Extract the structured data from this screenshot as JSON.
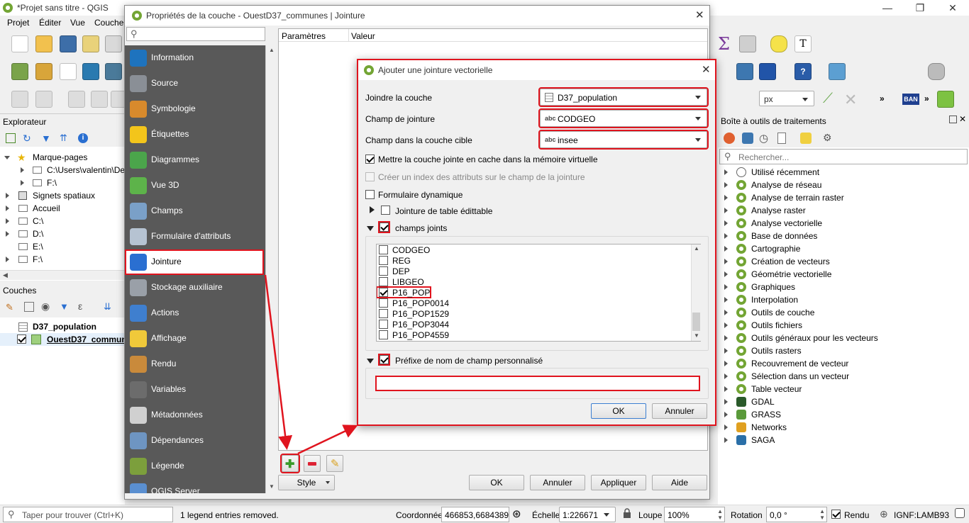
{
  "main_window": {
    "title": "*Projet sans titre - QGIS",
    "menu": [
      "Projet",
      "Éditer",
      "Vue",
      "Couche"
    ]
  },
  "explorer": {
    "title": "Explorateur",
    "items": [
      {
        "label": "Marque-pages",
        "level": 0
      },
      {
        "label": "C:\\Users\\valentin\\De",
        "level": 1
      },
      {
        "label": "F:\\",
        "level": 1
      },
      {
        "label": "Signets spatiaux",
        "level": 0
      },
      {
        "label": "Accueil",
        "level": 0
      },
      {
        "label": "C:\\",
        "level": 0
      },
      {
        "label": "D:\\",
        "level": 0
      },
      {
        "label": "E:\\",
        "level": 0
      },
      {
        "label": "F:\\",
        "level": 0
      }
    ]
  },
  "layers": {
    "title": "Couches",
    "items": [
      {
        "label": "D37_population",
        "checked": false
      },
      {
        "label": "OuestD37_commun",
        "checked": true
      }
    ]
  },
  "properties_dialog": {
    "title": "Propriétés de la couche - OuestD37_communes | Jointure",
    "search_placeholder": "",
    "sidebar": [
      {
        "label": "Information",
        "color": "#1e73be"
      },
      {
        "label": "Source",
        "color": "#8a8f96"
      },
      {
        "label": "Symbologie",
        "color": "#d88a2c"
      },
      {
        "label": "Étiquettes",
        "color": "#f3c51b"
      },
      {
        "label": "Diagrammes",
        "color": "#4ba54b"
      },
      {
        "label": "Vue 3D",
        "color": "#5db34a"
      },
      {
        "label": "Champs",
        "color": "#7aa0c8"
      },
      {
        "label": "Formulaire d'attributs",
        "color": "#b6c3d2"
      },
      {
        "label": "Jointure",
        "color": "#2a6fd1"
      },
      {
        "label": "Stockage auxiliaire",
        "color": "#9aa0a8"
      },
      {
        "label": "Actions",
        "color": "#3f7fcf"
      },
      {
        "label": "Affichage",
        "color": "#f0c93a"
      },
      {
        "label": "Rendu",
        "color": "#c98a3b"
      },
      {
        "label": "Variables",
        "color": "#6c6c6c"
      },
      {
        "label": "Métadonnées",
        "color": "#d0d0d0"
      },
      {
        "label": "Dépendances",
        "color": "#6e95c2"
      },
      {
        "label": "Légende",
        "color": "#7c9f3c"
      },
      {
        "label": "QGIS Server",
        "color": "#5a8fd0"
      }
    ],
    "table_headers": [
      "Paramètres",
      "Valeur"
    ],
    "style_button": "Style",
    "buttons": {
      "ok": "OK",
      "cancel": "Annuler",
      "apply": "Appliquer",
      "help": "Aide"
    }
  },
  "join_dialog": {
    "title": "Ajouter une jointure vectorielle",
    "join_layer_label": "Joindre la couche",
    "join_layer_value": "D37_population",
    "join_field_label": "Champ de jointure",
    "join_field_value": "CODGEO",
    "target_field_label": "Champ dans la couche cible",
    "target_field_value": "insee",
    "type_prefix": "abc",
    "cache_label": "Mettre la couche jointe en cache dans la mémoire virtuelle",
    "index_label": "Créer un index des attributs sur le champ de la jointure",
    "dynamic_form_label": "Formulaire dynamique",
    "editable_label": "Jointure de table édittable",
    "joined_fields_label": "champs joints",
    "fields": [
      {
        "name": "CODGEO",
        "checked": false
      },
      {
        "name": "REG",
        "checked": false
      },
      {
        "name": "DEP",
        "checked": false
      },
      {
        "name": "LIBGEO",
        "checked": false
      },
      {
        "name": "P16_POP",
        "checked": true
      },
      {
        "name": "P16_POP0014",
        "checked": false
      },
      {
        "name": "P16_POP1529",
        "checked": false
      },
      {
        "name": "P16_POP3044",
        "checked": false
      },
      {
        "name": "P16_POP4559",
        "checked": false
      }
    ],
    "prefix_label": "Préfixe de nom de champ personnalisé",
    "prefix_value": "",
    "ok": "OK",
    "cancel": "Annuler"
  },
  "toolbox": {
    "title": "Boîte à outils de traitements",
    "search_placeholder": "Rechercher...",
    "items": [
      "Utilisé récemment",
      "Analyse de réseau",
      "Analyse de terrain raster",
      "Analyse raster",
      "Analyse vectorielle",
      "Base de données",
      "Cartographie",
      "Création de vecteurs",
      "Géométrie vectorielle",
      "Graphiques",
      "Interpolation",
      "Outils de couche",
      "Outils fichiers",
      "Outils généraux pour les vecteurs",
      "Outils rasters",
      "Recouvrement de vecteur",
      "Sélection dans un vecteur",
      "Table vecteur",
      "GDAL",
      "GRASS",
      "Networks",
      "SAGA"
    ]
  },
  "toolbar_right": {
    "unit": "px"
  },
  "statusbar": {
    "search_placeholder": "Taper pour trouver (Ctrl+K)",
    "message": "1 legend entries removed.",
    "coord_label": "Coordonnée",
    "coord_value": "466853,6684389",
    "scale_label": "Échelle",
    "scale_value": "1:226671",
    "zoom_label": "Loupe",
    "zoom_value": "100%",
    "rotation_label": "Rotation",
    "rotation_value": "0,0 °",
    "render_label": "Rendu",
    "crs": "IGNF:LAMB93"
  },
  "colors": {
    "highlight": "#e0141e",
    "sidebar_bg": "#5a5a5a",
    "qgis_green": "#73a534"
  }
}
